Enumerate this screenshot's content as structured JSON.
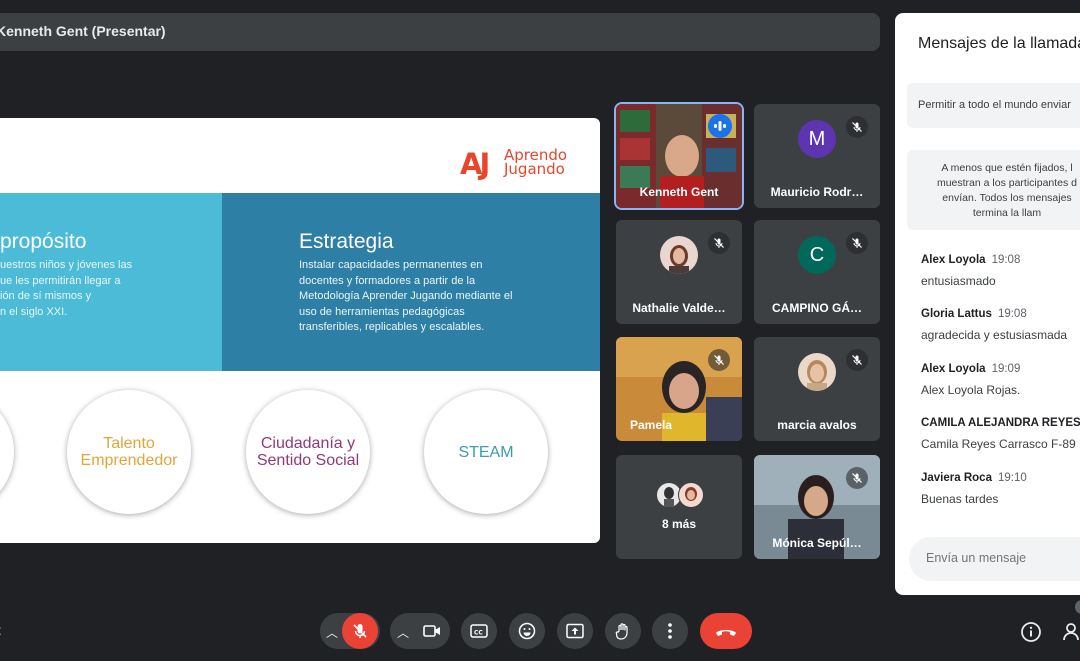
{
  "presenter": {
    "label": "Kenneth Gent (Presentar)"
  },
  "slide": {
    "logo_mark": "AJ",
    "logo_line1": "Aprendo",
    "logo_line2": "Jugando",
    "left_title": "propósito",
    "left_text": "uestros niños y jóvenes las\nue les permitirán llegar a\nión de sí mismos y\nn el siglo XXI.",
    "right_title": "Estrategia",
    "right_text": "Instalar capacidades permanentes en\ndocentes y formadores a partir de la\nMetodología Aprender Jugando mediante el\nuso de herramientas pedagógicas\ntransferibles, replicables y escalables.",
    "circles": [
      {
        "label": "Talento\nEmprendedor",
        "color": "#e2a53a"
      },
      {
        "label": "Ciudadanía y\nSentido Social",
        "color": "#8e3a7a"
      },
      {
        "label": "STEAM",
        "color": "#3a9bb0"
      }
    ]
  },
  "participants": [
    {
      "name": "Kenneth Gent",
      "type": "video",
      "speaking": true
    },
    {
      "name": "Mauricio Rodr…",
      "type": "letter",
      "letter": "M",
      "color": "#5e35b1",
      "muted": true
    },
    {
      "name": "Nathalie Valde…",
      "type": "photo",
      "muted": true
    },
    {
      "name": "CAMPINO GÁ…",
      "type": "letter",
      "letter": "C",
      "color": "#00695c",
      "muted": true
    },
    {
      "name": "Pamela",
      "type": "video",
      "muted": true
    },
    {
      "name": "marcia avalos",
      "type": "photo",
      "muted": true
    },
    {
      "name": "8 más",
      "type": "group"
    },
    {
      "name": "Mónica Sepúl…",
      "type": "video",
      "muted": true
    }
  ],
  "chat": {
    "title": "Mensajes de la llamada",
    "allow_label": "Permitir a todo el mundo enviar",
    "note": "A menos que estén fijados, l\nmuestran a los participantes d\nenvían. Todos los mensajes\ntermina la llam",
    "messages": [
      {
        "author": "Alex Loyola",
        "time": "19:08",
        "text": "entusiasmado"
      },
      {
        "author": "Gloria Lattus",
        "time": "19:08",
        "text": "agradecida y estusiasmada"
      },
      {
        "author": "Alex Loyola",
        "time": "19:09",
        "text": "Alex Loyola Rojas."
      },
      {
        "author": "CAMILA ALEJANDRA REYES C",
        "time": "",
        "text": "Camila Reyes Carrasco F-89"
      },
      {
        "author": "Javiera Roca",
        "time": "19:10",
        "text": "Buenas tardes"
      }
    ],
    "input_placeholder": "Envía un mensaje"
  },
  "bottom": {
    "meeting_code_fragment": "t"
  },
  "colors": {
    "leave": "#ea4335",
    "mic_off": "#ea4335",
    "speaking_border": "#8ab4f8"
  }
}
